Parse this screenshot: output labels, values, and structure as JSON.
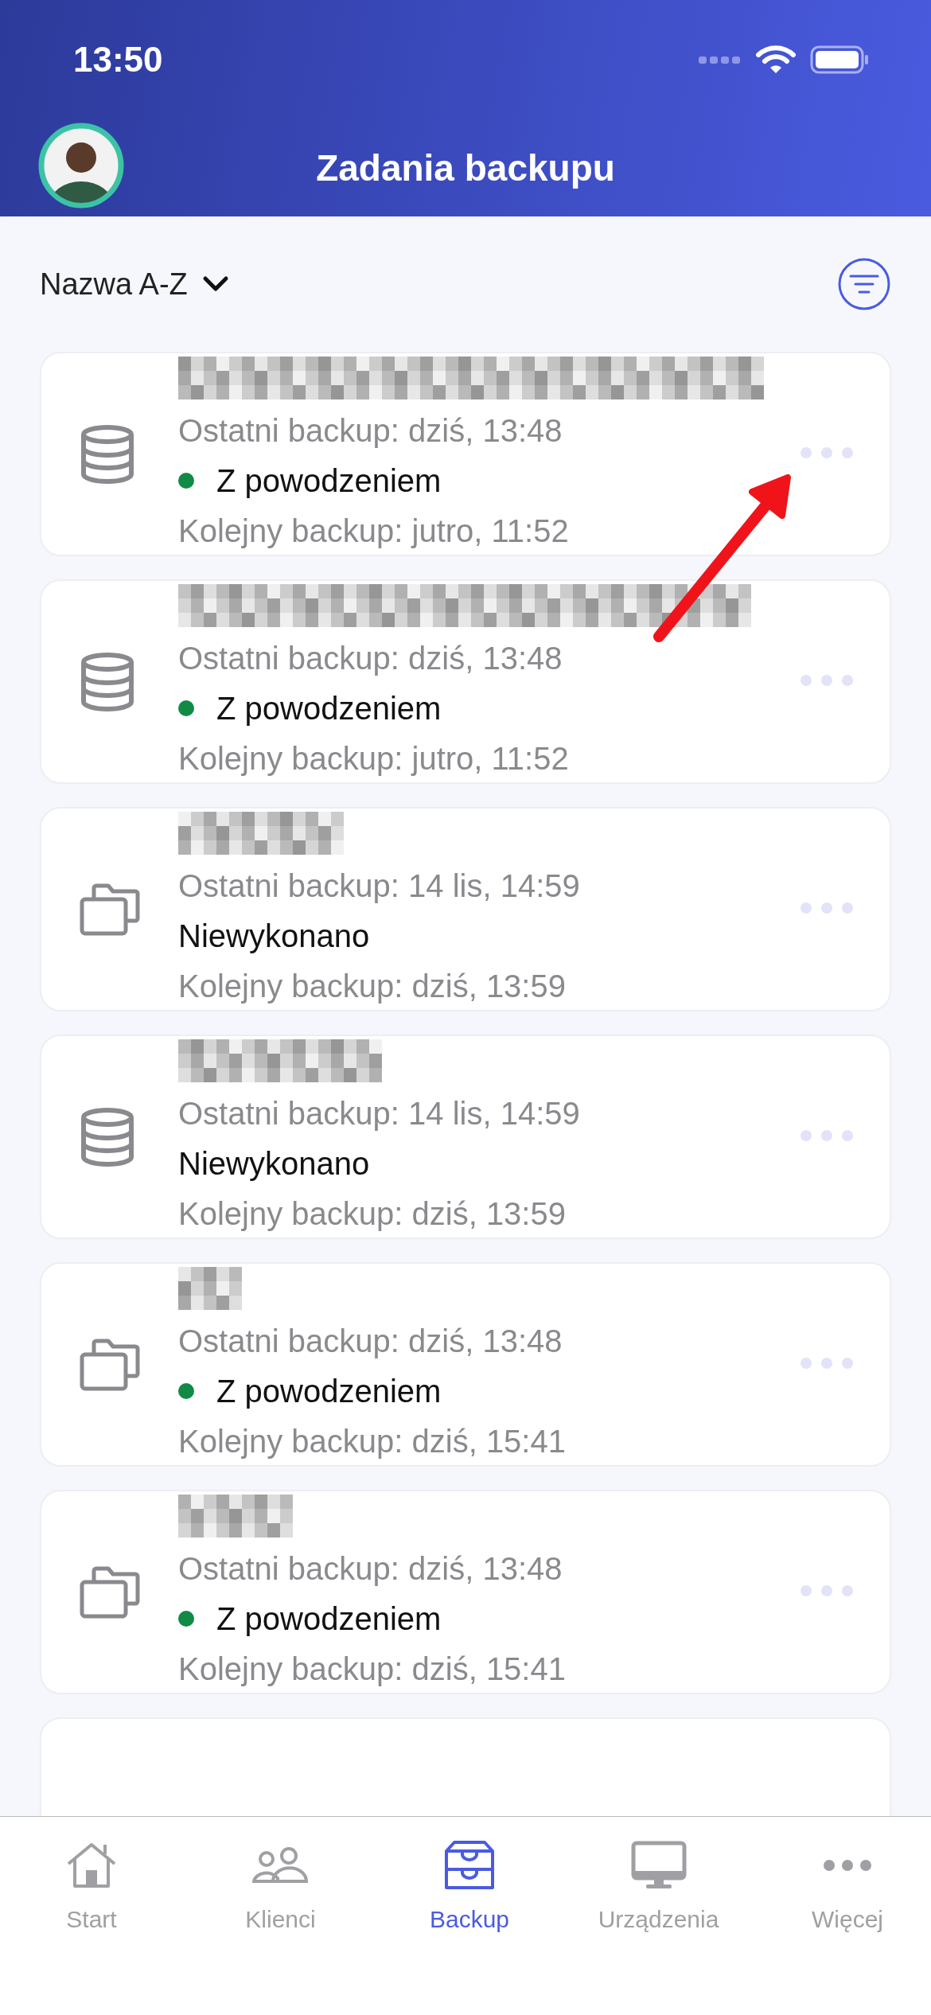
{
  "status_bar": {
    "time": "13:50"
  },
  "header": {
    "title": "Zadania backupu"
  },
  "sort": {
    "label": "Nazwa A-Z"
  },
  "jobs": [
    {
      "kind": "database",
      "last": "Ostatni backup: dziś, 13:48",
      "result": "Z powodzeniem",
      "success": true,
      "next": "Kolejny backup: jutro, 11:52"
    },
    {
      "kind": "database",
      "last": "Ostatni backup: dziś, 13:48",
      "result": "Z powodzeniem",
      "success": true,
      "next": "Kolejny backup: jutro, 11:52"
    },
    {
      "kind": "folder",
      "last": "Ostatni backup: 14 lis, 14:59",
      "result": "Niewykonano",
      "success": false,
      "next": "Kolejny backup: dziś, 13:59"
    },
    {
      "kind": "database",
      "last": "Ostatni backup: 14 lis, 14:59",
      "result": "Niewykonano",
      "success": false,
      "next": "Kolejny backup: dziś, 13:59"
    },
    {
      "kind": "folder",
      "last": "Ostatni backup: dziś, 13:48",
      "result": "Z powodzeniem",
      "success": true,
      "next": "Kolejny backup: dziś, 15:41"
    },
    {
      "kind": "folder",
      "last": "Ostatni backup: dziś, 13:48",
      "result": "Z powodzeniem",
      "success": true,
      "next": "Kolejny backup: dziś, 15:41"
    }
  ],
  "tabs": [
    {
      "kind": "home",
      "label": "Start",
      "selected": false
    },
    {
      "kind": "people",
      "label": "Klienci",
      "selected": false
    },
    {
      "kind": "archive",
      "label": "Backup",
      "selected": true
    },
    {
      "kind": "monitor",
      "label": "Urządzenia",
      "selected": false
    },
    {
      "kind": "more",
      "label": "Więcej",
      "selected": false
    }
  ]
}
